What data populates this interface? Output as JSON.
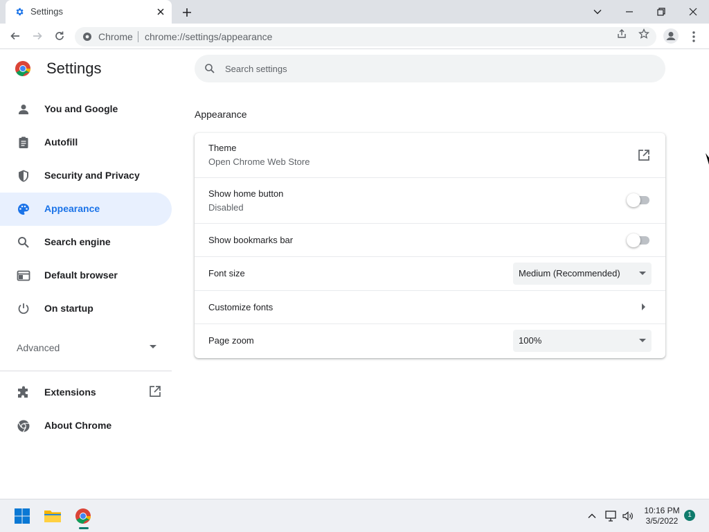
{
  "tab": {
    "title": "Settings"
  },
  "toolbar": {
    "site_label": "Chrome",
    "url": "chrome://settings/appearance"
  },
  "header": {
    "title": "Settings",
    "search_placeholder": "Search settings"
  },
  "sidebar": {
    "items": [
      {
        "label": "You and Google",
        "icon": "person-icon"
      },
      {
        "label": "Autofill",
        "icon": "clipboard-icon"
      },
      {
        "label": "Security and Privacy",
        "icon": "shield-icon"
      },
      {
        "label": "Appearance",
        "icon": "palette-icon",
        "active": true
      },
      {
        "label": "Search engine",
        "icon": "search-icon"
      },
      {
        "label": "Default browser",
        "icon": "browser-window-icon"
      },
      {
        "label": "On startup",
        "icon": "power-icon"
      }
    ],
    "advanced_label": "Advanced",
    "extensions_label": "Extensions",
    "about_label": "About Chrome"
  },
  "main": {
    "section_title": "Appearance",
    "theme": {
      "label": "Theme",
      "sub": "Open Chrome Web Store"
    },
    "home_button": {
      "label": "Show home button",
      "sub": "Disabled",
      "enabled": false
    },
    "bookmarks_bar": {
      "label": "Show bookmarks bar",
      "enabled": false
    },
    "font_size": {
      "label": "Font size",
      "value": "Medium (Recommended)"
    },
    "customize_fonts": {
      "label": "Customize fonts"
    },
    "page_zoom": {
      "label": "Page zoom",
      "value": "100%"
    }
  },
  "taskbar": {
    "time": "10:16 PM",
    "date": "3/5/2022",
    "notification_count": "1"
  },
  "colors": {
    "accent": "#1a73e8",
    "active_nav_bg": "#e8f0fe",
    "toggle_off": "#bdc1c6"
  }
}
